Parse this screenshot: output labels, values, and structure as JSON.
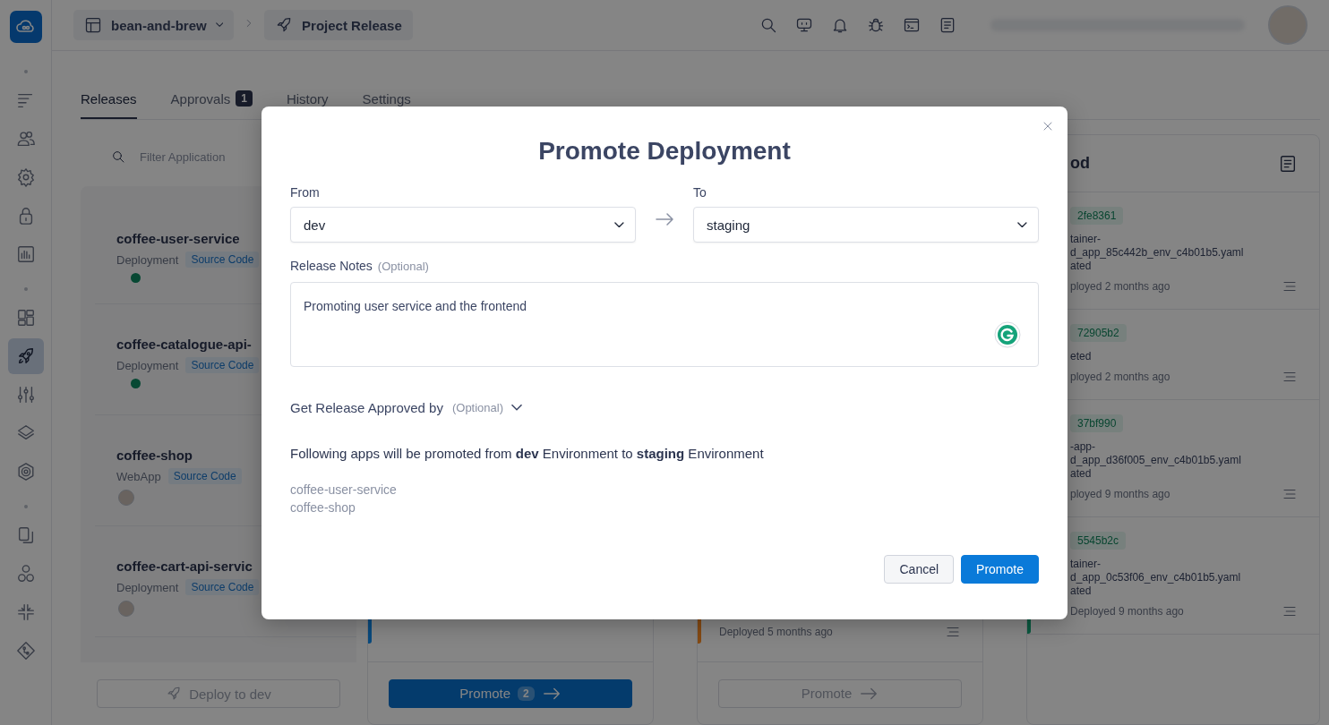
{
  "sidebar": {
    "groups": [
      {
        "items": [
          {
            "selected": false
          },
          {
            "selected": false
          },
          {
            "selected": false
          },
          {
            "selected": false
          },
          {
            "selected": false
          }
        ]
      },
      {
        "items": [
          {
            "selected": false
          },
          {
            "selected": true
          },
          {
            "selected": false
          },
          {
            "selected": false
          },
          {
            "selected": false
          }
        ]
      },
      {
        "items": [
          {
            "selected": false
          },
          {
            "selected": false
          },
          {
            "selected": false
          },
          {
            "selected": false
          }
        ]
      }
    ]
  },
  "breadcrumb": {
    "workspace": "bean-and-brew",
    "page": "Project Release"
  },
  "tabs": [
    {
      "label": "Releases",
      "selected": true
    },
    {
      "label": "Approvals",
      "badge": "1",
      "selected": false
    },
    {
      "label": "History",
      "selected": false
    },
    {
      "label": "Settings",
      "selected": false
    }
  ],
  "columns": [
    {
      "kind": "apps",
      "filter_placeholder": "Filter Application",
      "apps": [
        {
          "name": "coffee-user-service",
          "type": "Deployment",
          "tag": "Source Code",
          "kind": "dot"
        },
        {
          "name": "coffee-catalogue-api-",
          "type": "Deployment",
          "tag": "Source Code",
          "kind": "dot"
        },
        {
          "name": "coffee-shop",
          "type": "WebApp",
          "tag": "Source Code",
          "kind": "avatar"
        },
        {
          "name": "coffee-cart-api-servic",
          "type": "Deployment",
          "tag": "Source Code",
          "kind": "avatar"
        }
      ],
      "action": {
        "label": "Deploy to dev",
        "disabled": true
      }
    },
    {
      "kind": "stage",
      "color": "#0a4a7e",
      "action": {
        "label": "Promote",
        "count": "2",
        "disabled": false
      }
    },
    {
      "kind": "stage",
      "color": "#8a4a14",
      "last_deployed": "Deployed 5 months ago",
      "action": {
        "label": "Promote",
        "disabled": true
      }
    },
    {
      "kind": "stage",
      "color": "#0b5a40",
      "title": "od",
      "entries": [
        {
          "commit": "2fe8361",
          "lines": [
            "tainer-",
            "d_app_85c442b_env_c4b01b5.yaml",
            "ated"
          ],
          "deployed": "ployed 2 months ago"
        },
        {
          "commit": "72905b2",
          "lines": [
            "eted"
          ],
          "deployed": "ployed 2 months ago"
        },
        {
          "commit": "37bf990",
          "lines": [
            "-app-",
            "d_app_d36f005_env_c4b01b5.yaml",
            "ated"
          ],
          "deployed": "ployed 9 months ago"
        },
        {
          "commit": "5545b2c",
          "lines": [
            "tainer-",
            "d_app_0c53f06_env_c4b01b5.yaml",
            "ated"
          ],
          "deployed": "Deployed 9 months ago"
        }
      ]
    }
  ],
  "modal": {
    "title": "Promote Deployment",
    "from": {
      "label": "From",
      "value": "dev"
    },
    "to": {
      "label": "To",
      "value": "staging"
    },
    "notes": {
      "label": "Release Notes",
      "hint": "(Optional)",
      "value": "Promoting user service and the frontend"
    },
    "approvers": {
      "label": "Get Release Approved by",
      "hint": "(Optional)",
      "expanded": false
    },
    "summary": "Following apps will be promoted from **dev** Environment to **staging** Environment",
    "apps": [
      "coffee-user-service",
      "coffee-shop"
    ],
    "buttons": [
      {
        "label": "Cancel",
        "kind": "secondary"
      },
      {
        "label": "Promote",
        "kind": "primary"
      }
    ]
  }
}
